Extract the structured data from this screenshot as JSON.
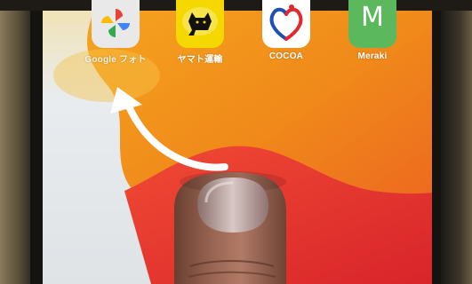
{
  "home_screen": {
    "apps": [
      {
        "label": "Google フォト",
        "icon": "google-photos-icon"
      },
      {
        "label": "ヤマト運輸",
        "icon": "yamato-cat-icon"
      },
      {
        "label": "COCOA",
        "icon": "cocoa-heart-icon"
      },
      {
        "label": "Meraki",
        "icon": "meraki-m-icon",
        "letter": "M"
      }
    ]
  },
  "colors": {
    "wallpaper_orange": "#f08a1a",
    "wallpaper_red": "#e8322e",
    "wallpaper_light": "#e9ecef",
    "meraki_green": "#5cb85c",
    "yamato_yellow": "#f5d800",
    "arrow": "#ffffff"
  }
}
